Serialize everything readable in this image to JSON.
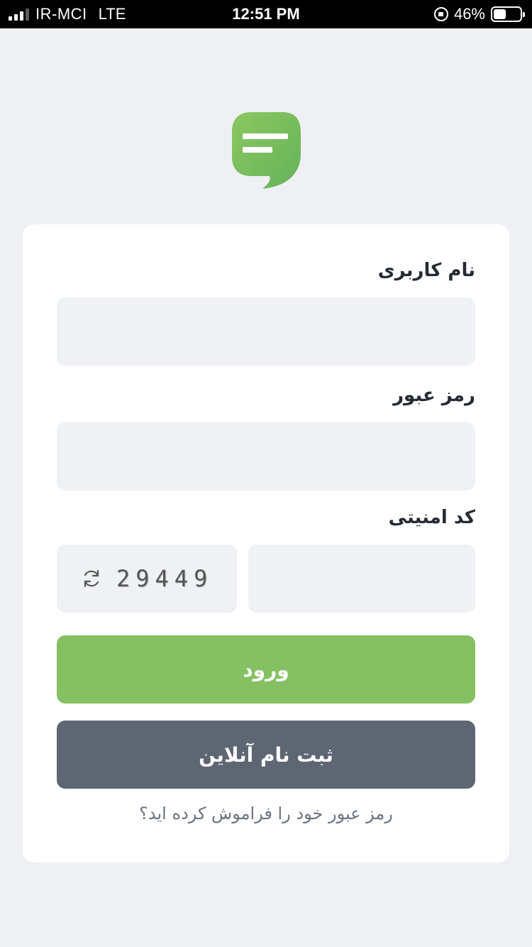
{
  "status_bar": {
    "carrier": "IR-MCI",
    "network": "LTE",
    "time": "12:51 PM",
    "battery_percent": "46%",
    "battery_level": 0.46,
    "signal_bars": 3
  },
  "form": {
    "username_label": "نام کاربری",
    "username_value": "",
    "password_label": "رمز عبور",
    "password_value": "",
    "captcha_label": "کد امنیتی",
    "captcha_code": "29449",
    "captcha_value": ""
  },
  "buttons": {
    "login": "ورود",
    "register": "ثبت نام آنلاین"
  },
  "links": {
    "forgot_password": "رمز عبور خود را فراموش کرده اید؟"
  },
  "colors": {
    "primary_green": "#85c062",
    "secondary_gray": "#5f6673",
    "background": "#eff0f4"
  }
}
